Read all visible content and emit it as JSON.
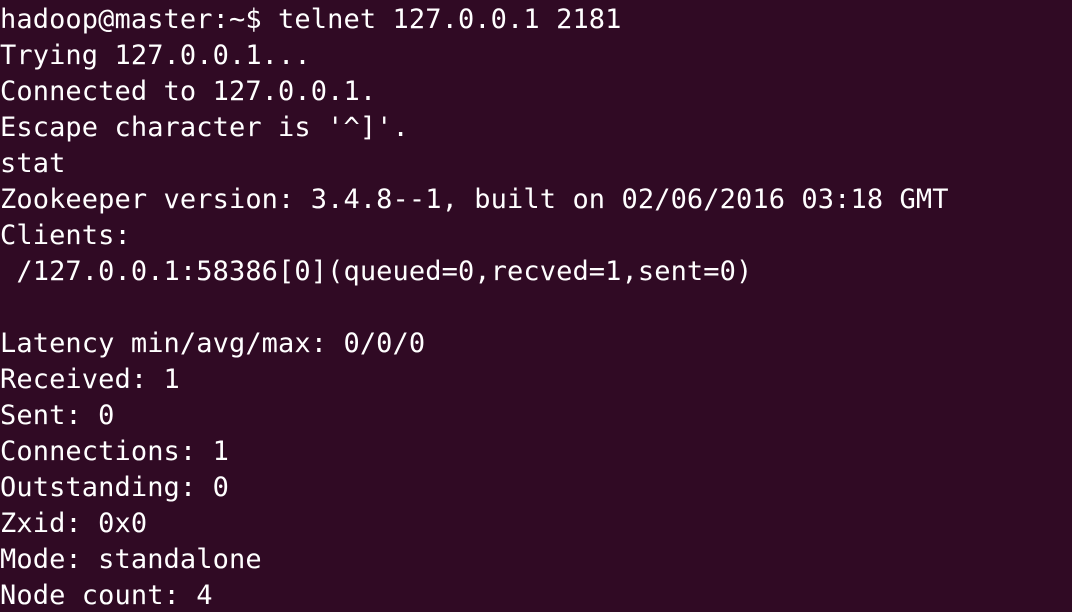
{
  "terminal": {
    "background_color": "#300a24",
    "text_color": "#ffffff",
    "lines": [
      "hadoop@master:~$ telnet 127.0.0.1 2181",
      "Trying 127.0.0.1...",
      "Connected to 127.0.0.1.",
      "Escape character is '^]'.",
      "stat",
      "Zookeeper version: 3.4.8--1, built on 02/06/2016 03:18 GMT",
      "Clients:",
      " /127.0.0.1:58386[0](queued=0,recved=1,sent=0)",
      "",
      "Latency min/avg/max: 0/0/0",
      "Received: 1",
      "Sent: 0",
      "Connections: 1",
      "Outstanding: 0",
      "Zxid: 0x0",
      "Mode: standalone",
      "Node count: 4"
    ]
  }
}
